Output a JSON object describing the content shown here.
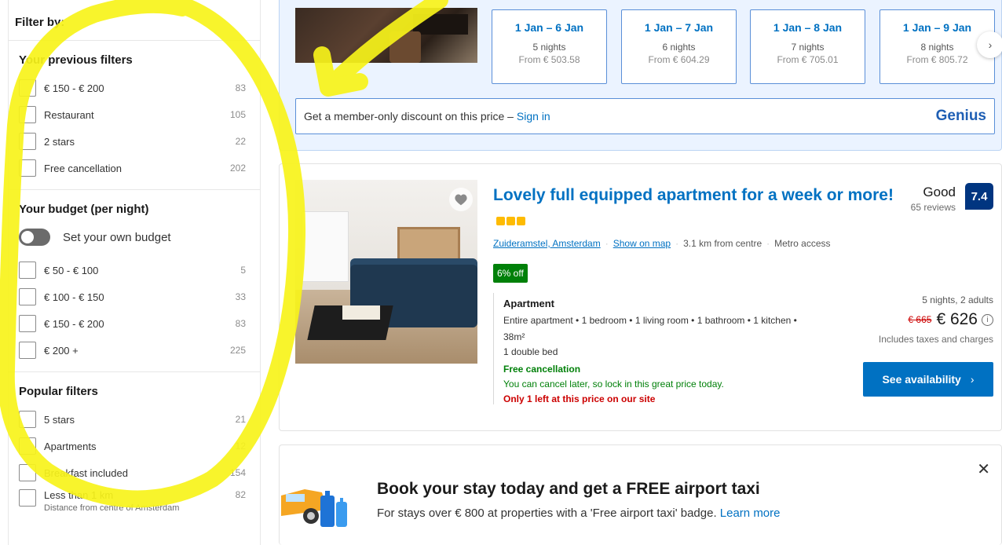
{
  "sidebar": {
    "filter_by": "Filter by:",
    "previous": {
      "title": "Your previous filters",
      "items": [
        {
          "label": "€ 150 - € 200",
          "count": "83"
        },
        {
          "label": "Restaurant",
          "count": "105"
        },
        {
          "label": "2 stars",
          "count": "22"
        },
        {
          "label": "Free cancellation",
          "count": "202"
        }
      ]
    },
    "budget": {
      "title": "Your budget (per night)",
      "toggle_label": "Set your own budget",
      "items": [
        {
          "label": "€ 50 - € 100",
          "count": "5"
        },
        {
          "label": "€ 100 - € 150",
          "count": "33"
        },
        {
          "label": "€ 150 - € 200",
          "count": "83"
        },
        {
          "label": "€ 200 +",
          "count": "225"
        }
      ]
    },
    "popular": {
      "title": "Popular filters",
      "items": [
        {
          "label": "5 stars",
          "count": "21"
        },
        {
          "label": "Apartments",
          "count": "12"
        },
        {
          "label": "Breakfast included",
          "count": "154"
        },
        {
          "label": "Less than 1 km",
          "count": "82",
          "sub": "Distance from centre of Amsterdam"
        }
      ]
    }
  },
  "dates": [
    {
      "range": "1 Jan – 6 Jan",
      "nights": "5 nights",
      "from": "From € 503.58"
    },
    {
      "range": "1 Jan – 7 Jan",
      "nights": "6 nights",
      "from": "From € 604.29"
    },
    {
      "range": "1 Jan – 8 Jan",
      "nights": "7 nights",
      "from": "From € 705.01"
    },
    {
      "range": "1 Jan – 9 Jan",
      "nights": "8 nights",
      "from": "From € 805.72"
    }
  ],
  "member_bar": {
    "text": "Get a member-only discount on this price –",
    "signin": "Sign in",
    "genius": "Genius"
  },
  "property": {
    "title": "Lovely full equipped apartment for a week or more!",
    "rating_word": "Good",
    "reviews": "65 reviews",
    "score": "7.4",
    "location": "Zuideramstel, Amsterdam",
    "show_on_map": "Show on map",
    "distance": "3.1 km from centre",
    "metro": "Metro access",
    "deal": "6% off",
    "room_type": "Apartment",
    "room_desc": "Entire apartment • 1 bedroom • 1 living room • 1 bathroom • 1 kitchen • 38m²",
    "bed": "1 double bed",
    "free_cancel": "Free cancellation",
    "cancel_note": "You can cancel later, so lock in this great price today.",
    "scarcity": "Only 1 left at this price on our site",
    "stay_info": "5 nights, 2 adults",
    "old_price": "€ 665",
    "new_price": "€ 626",
    "taxes": "Includes taxes and charges",
    "availability_btn": "See availability"
  },
  "taxi": {
    "title": "Book your stay today and get a FREE airport taxi",
    "sub": "For stays over € 800 at properties with a 'Free airport taxi' badge.",
    "learn_more": "Learn more"
  },
  "colors": {
    "brand_blue": "#0071c2",
    "score_navy": "#003580",
    "deal_green": "#008009",
    "alert_red": "#cc0000",
    "annotation_yellow": "#f7f31a"
  }
}
